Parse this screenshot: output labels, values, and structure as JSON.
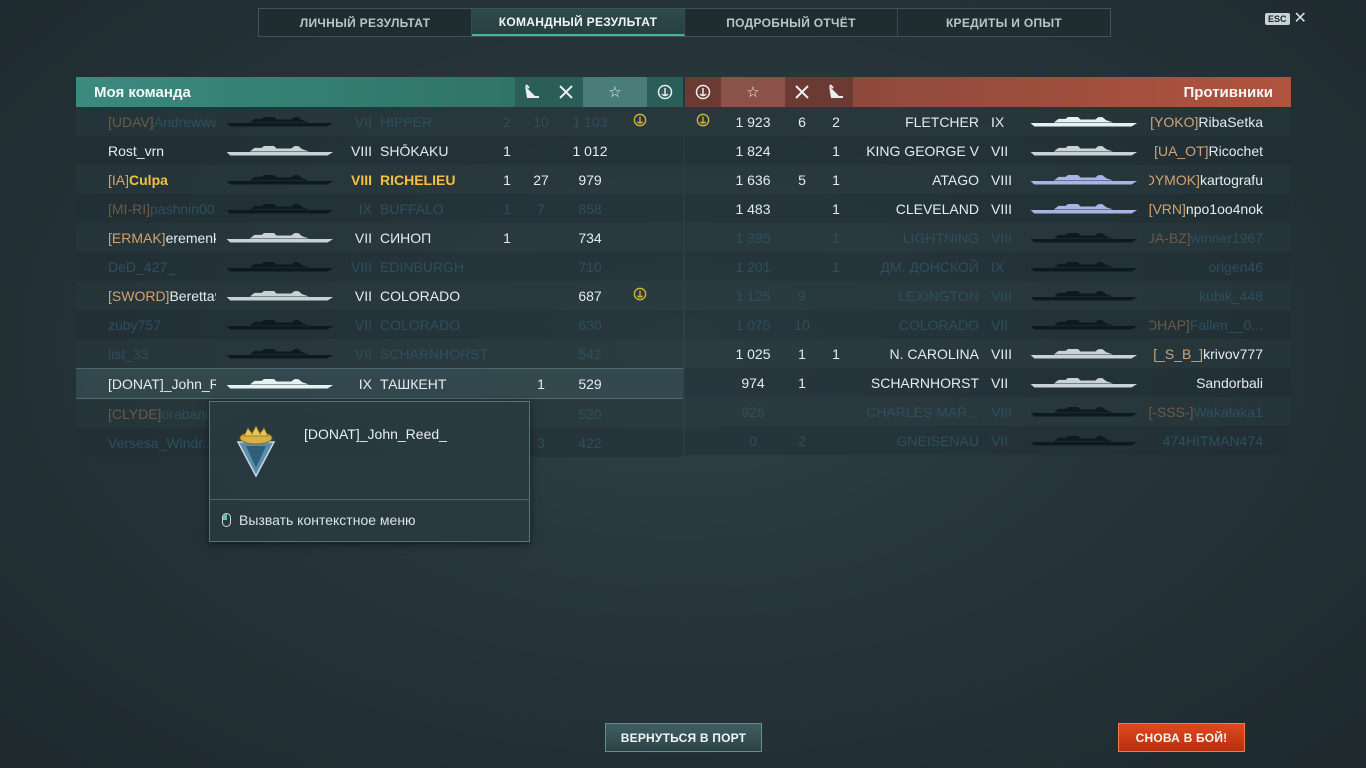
{
  "tabs": [
    "ЛИЧНЫЙ РЕЗУЛЬТАТ",
    "КОМАНДНЫЙ РЕЗУЛЬТАТ",
    "ПОДРОБНЫЙ ОТЧЁТ",
    "КРЕДИТЫ И ОПЫТ"
  ],
  "active_tab_index": 1,
  "esc_label": "ESC",
  "my_team": {
    "title": "Моя команда",
    "rows": [
      {
        "clan": "[UDAV]",
        "player": "Andrewwww...",
        "tier": "VII",
        "ship": "HIPPER",
        "kills": "2",
        "frags": "10",
        "xp": "1 103",
        "medal": true,
        "state": "dim",
        "silhouette": "dark"
      },
      {
        "clan": "",
        "player": "Rost_vrn",
        "tier": "VIII",
        "ship": "SHŌKAKU",
        "kills": "1",
        "frags": "",
        "xp": "1 012",
        "medal": false,
        "state": "normal",
        "silhouette": "light"
      },
      {
        "clan": "[IA]",
        "player": "Culpa",
        "tier": "VIII",
        "ship": "RICHELIEU",
        "kills": "1",
        "frags": "27",
        "xp": "979",
        "medal": false,
        "state": "self",
        "silhouette": "dark"
      },
      {
        "clan": "[MI-RI]",
        "player": "pashnin00",
        "tier": "IX",
        "ship": "BUFFALO",
        "kills": "1",
        "frags": "7",
        "xp": "858",
        "medal": false,
        "state": "dim",
        "silhouette": "dark"
      },
      {
        "clan": "[ERMAK]",
        "player": "eremenk...",
        "tier": "VII",
        "ship": "СИНОП",
        "kills": "1",
        "frags": "",
        "xp": "734",
        "medal": false,
        "state": "normal",
        "silhouette": "light"
      },
      {
        "clan": "",
        "player": "DeD_427_",
        "tier": "VIII",
        "ship": "EDINBURGH",
        "kills": "",
        "frags": "",
        "xp": "710",
        "medal": false,
        "state": "dim",
        "silhouette": "dark"
      },
      {
        "clan": "[SWORD]",
        "player": "Beretta9...",
        "tier": "VII",
        "ship": "COLORADO",
        "kills": "",
        "frags": "",
        "xp": "687",
        "medal": true,
        "state": "normal",
        "silhouette": "light"
      },
      {
        "clan": "",
        "player": "zuby757",
        "tier": "VII",
        "ship": "COLORADO",
        "kills": "",
        "frags": "",
        "xp": "630",
        "medal": false,
        "state": "dim",
        "silhouette": "dark"
      },
      {
        "clan": "",
        "player": "list_33",
        "tier": "VII",
        "ship": "SCHARNHORST",
        "kills": "",
        "frags": "",
        "xp": "542",
        "medal": false,
        "state": "dim",
        "silhouette": "dark"
      },
      {
        "clan": "",
        "player": "[DONAT]_John_Re...",
        "tier": "IX",
        "ship": "ТАШКЕНТ",
        "kills": "",
        "frags": "1",
        "xp": "529",
        "medal": false,
        "state": "hl",
        "silhouette": "white"
      },
      {
        "clan": "[CLYDE]",
        "player": "orabani",
        "tier": "VIII",
        "ship": "CHARLES MAR...",
        "kills": "",
        "frags": "",
        "xp": "520",
        "medal": false,
        "state": "dim",
        "silhouette": "dark"
      },
      {
        "clan": "",
        "player": "Versesa_Windr...",
        "tier": "",
        "ship": "",
        "kills": "",
        "frags": "3",
        "xp": "422",
        "medal": false,
        "state": "dim",
        "silhouette": "dark"
      }
    ]
  },
  "enemy_team": {
    "title": "Противники",
    "rows": [
      {
        "medal": true,
        "xp": "1 923",
        "frags": "6",
        "kills": "2",
        "ship": "FLETCHER",
        "tier": "IX",
        "clan": "[YOKO]",
        "player": "RibaSetka",
        "state": "normal",
        "silhouette": "white"
      },
      {
        "medal": false,
        "xp": "1 824",
        "frags": "",
        "kills": "1",
        "ship": "KING GEORGE V",
        "tier": "VII",
        "clan": "[UA_OT]",
        "player": "Ricochet",
        "state": "normal",
        "silhouette": "light"
      },
      {
        "medal": false,
        "xp": "1 636",
        "frags": "5",
        "kills": "1",
        "ship": "ATAGO",
        "tier": "VIII",
        "clan": "[DYMOK]",
        "player": "kartografu",
        "state": "normal",
        "silhouette": "lilac"
      },
      {
        "medal": false,
        "xp": "1 483",
        "frags": "",
        "kills": "1",
        "ship": "CLEVELAND",
        "tier": "VIII",
        "clan": "[VRN]",
        "player": "npo1oo4nok",
        "state": "normal",
        "silhouette": "lilac"
      },
      {
        "medal": false,
        "xp": "1 395",
        "frags": "",
        "kills": "1",
        "ship": "LIGHTNING",
        "tier": "VIII",
        "clan": "[UA-BZ]",
        "player": "winner1967",
        "state": "dim",
        "silhouette": "dark"
      },
      {
        "medal": false,
        "xp": "1 201",
        "frags": "",
        "kills": "1",
        "ship": "ДМ. ДОНСКОЙ",
        "tier": "IX",
        "clan": "",
        "player": "origen46",
        "state": "dim",
        "silhouette": "dark"
      },
      {
        "medal": false,
        "xp": "1 125",
        "frags": "9",
        "kills": "",
        "ship": "LEXINGTON",
        "tier": "VIII",
        "clan": "",
        "player": "kubik_448",
        "state": "dim",
        "silhouette": "dark"
      },
      {
        "medal": false,
        "xp": "1 075",
        "frags": "10",
        "kills": "",
        "ship": "COLORADO",
        "tier": "VII",
        "clan": "[COHAP]",
        "player": "Fallen__0...",
        "state": "dim",
        "silhouette": "dark"
      },
      {
        "medal": false,
        "xp": "1 025",
        "frags": "1",
        "kills": "1",
        "ship": "N. CAROLINA",
        "tier": "VIII",
        "clan": "[_S_B_]",
        "player": "krivov777",
        "state": "normal",
        "silhouette": "light"
      },
      {
        "medal": false,
        "xp": "974",
        "frags": "1",
        "kills": "",
        "ship": "SCHARNHORST",
        "tier": "VII",
        "clan": "",
        "player": "Sandorbali",
        "state": "normal",
        "silhouette": "light"
      },
      {
        "medal": false,
        "xp": "926",
        "frags": "",
        "kills": "",
        "ship": "CHARLES MAR...",
        "tier": "VIII",
        "clan": "[-SSS-]",
        "player": "Wakataka1",
        "state": "dim",
        "silhouette": "dark"
      },
      {
        "medal": false,
        "xp": "0",
        "frags": "2",
        "kills": "",
        "ship": "GNEISENAU",
        "tier": "VII",
        "clan": "",
        "player": "474HITMAN474",
        "state": "dim",
        "silhouette": "dark"
      }
    ]
  },
  "header_icons": {
    "kills": "sunk-ship-icon",
    "frags": "crossed-swords-icon",
    "xp": "star-icon",
    "medal": "anchor-medal-icon"
  },
  "tooltip": {
    "player": "[DONAT]_John_Reed_",
    "action": "Вызвать контекстное меню"
  },
  "buttons": {
    "port": "ВЕРНУТЬСЯ В ПОРТ",
    "battle": "СНОВА В БОЙ!"
  },
  "colors": {
    "my_team": "#3b8a7f",
    "enemy": "#b0533f",
    "self_highlight": "#f3c140",
    "battle_button": "#d43f18"
  }
}
